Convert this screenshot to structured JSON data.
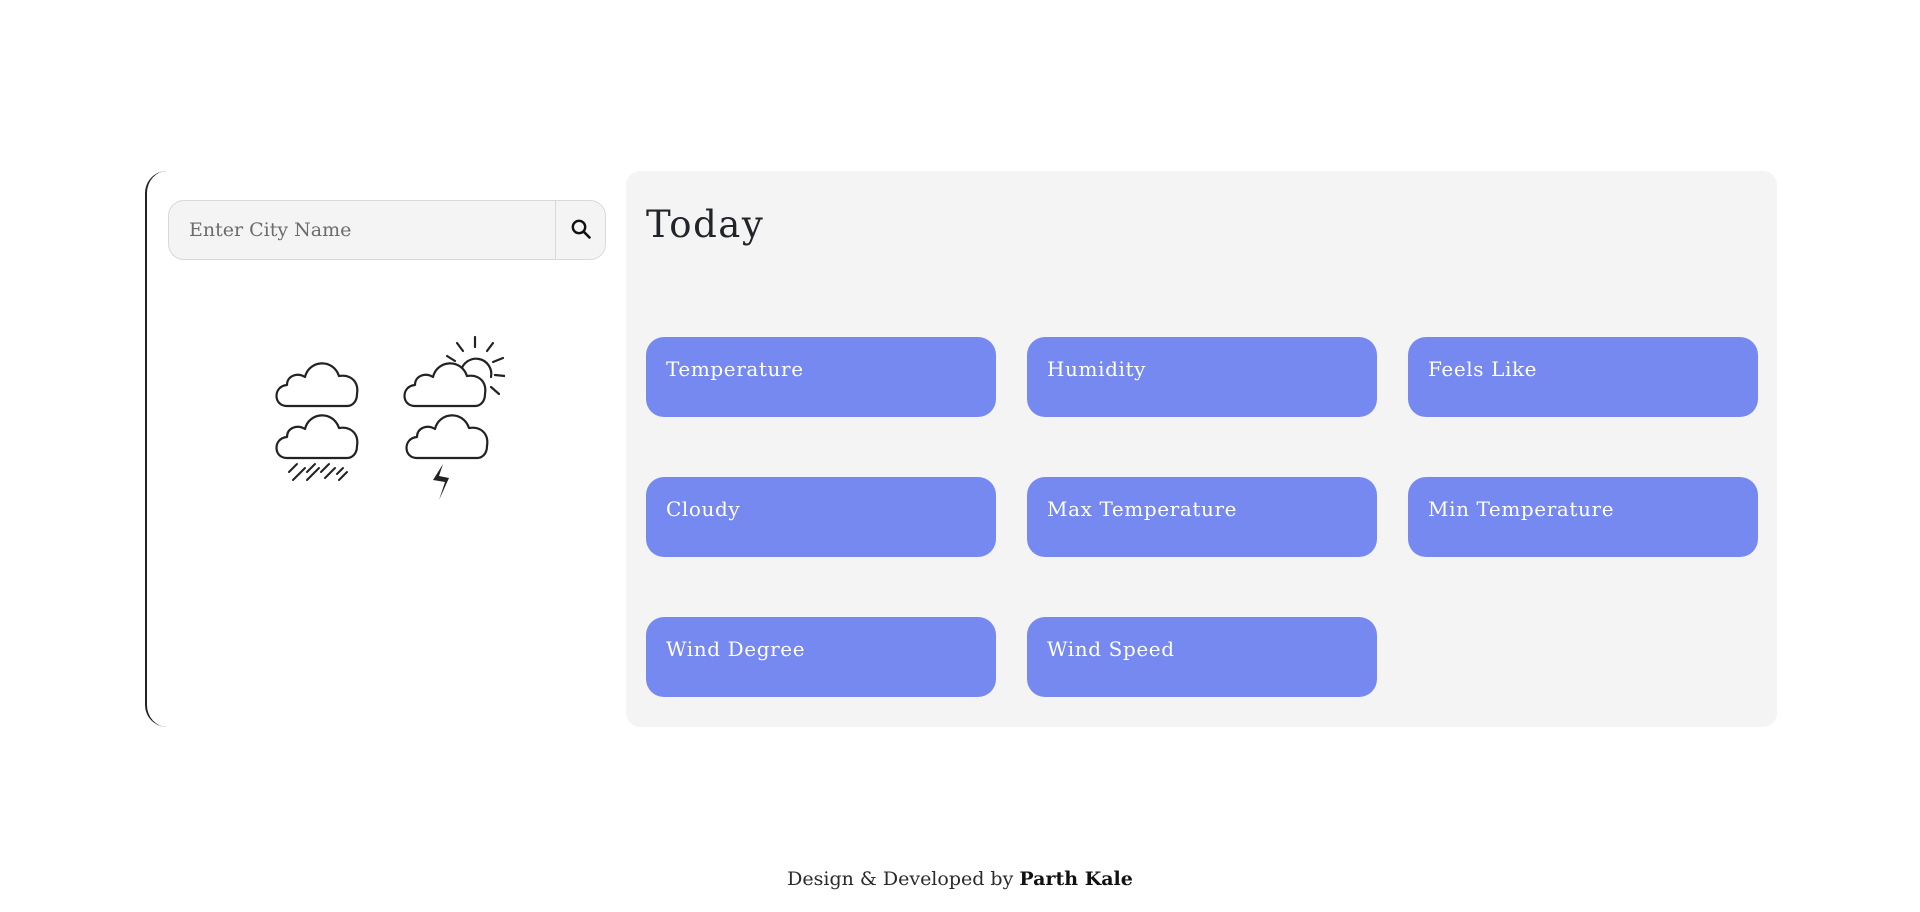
{
  "search": {
    "placeholder": "Enter City Name",
    "button_icon": "search-icon"
  },
  "weather_icons": [
    "cloud-icon",
    "partly-sunny-icon",
    "rain-icon",
    "thunderstorm-icon"
  ],
  "today": {
    "title": "Today",
    "cards": [
      {
        "label": "Temperature"
      },
      {
        "label": "Humidity"
      },
      {
        "label": "Feels Like"
      },
      {
        "label": "Cloudy"
      },
      {
        "label": "Max Temperature"
      },
      {
        "label": "Min Temperature"
      },
      {
        "label": "Wind Degree"
      },
      {
        "label": "Wind Speed"
      }
    ]
  },
  "footer": {
    "prefix": "Design & Developed by",
    "author": "Parth Kale"
  },
  "colors": {
    "card": "#7689f0",
    "panel": "#f4f4f4"
  }
}
